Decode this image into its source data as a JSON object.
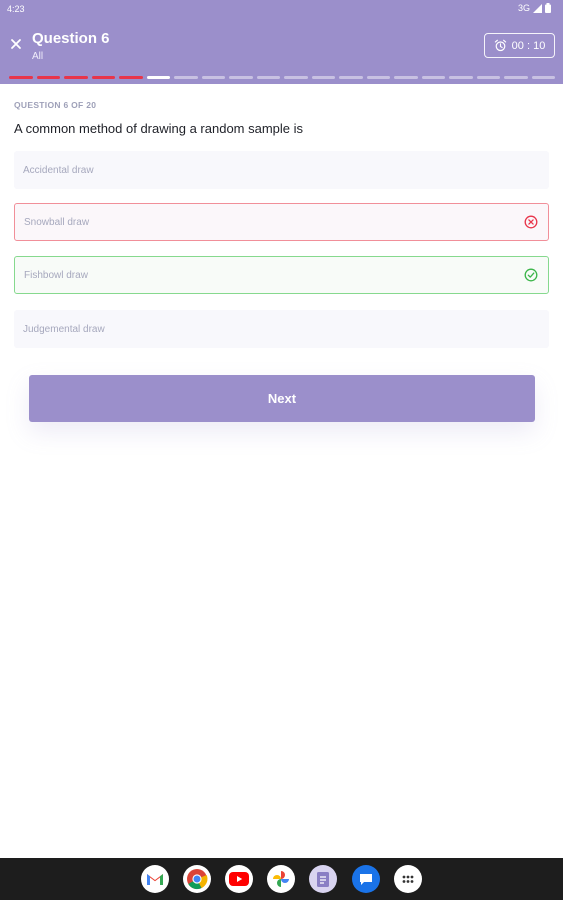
{
  "status_bar": {
    "time": "4:23",
    "network": "3G"
  },
  "app_bar": {
    "title": "Question 6",
    "subtitle": "All",
    "timer": "00 : 10"
  },
  "progress": {
    "total": 20,
    "current_index": 6,
    "answered_wrong": 5
  },
  "question": {
    "counter": "QUESTION 6 OF 20",
    "text": "A common method of drawing a random sample is"
  },
  "options": [
    {
      "label": "Accidental draw",
      "state": "default"
    },
    {
      "label": "Snowball draw",
      "state": "wrong"
    },
    {
      "label": "Fishbowl draw",
      "state": "correct"
    },
    {
      "label": "Judgemental draw",
      "state": "default"
    }
  ],
  "next_button": {
    "label": "Next"
  },
  "dock": {
    "apps": [
      "gmail-icon",
      "chrome-icon",
      "youtube-icon",
      "photos-icon",
      "docs-icon",
      "messages-icon",
      "app-drawer-icon"
    ]
  },
  "colors": {
    "primary": "#9b8fcb",
    "wrong": "#e8354a",
    "correct": "#3cb54a"
  }
}
